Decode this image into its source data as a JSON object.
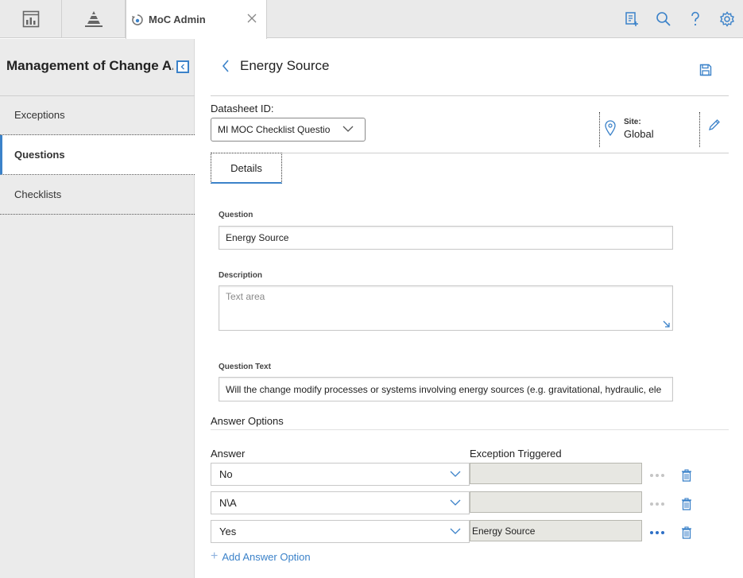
{
  "topbar": {
    "active_tab_label": "MoC Admin",
    "icons": [
      "dashboard-icon",
      "pyramid-icon",
      "moc-tab-icon",
      "close-icon",
      "add-document-icon",
      "search-icon",
      "help-icon",
      "gear-icon"
    ]
  },
  "sidebar": {
    "title": "Management of Change A...",
    "items": [
      {
        "label": "Exceptions",
        "active": false
      },
      {
        "label": "Questions",
        "active": true
      },
      {
        "label": "Checklists",
        "active": false
      }
    ]
  },
  "main": {
    "title": "Energy Source",
    "datasheet_label": "Datasheet ID:",
    "datasheet_value": "MI MOC Checklist Questio",
    "site_label": "Site:",
    "site_value": "Global",
    "tab_details": "Details",
    "fields": {
      "question_label": "Question",
      "question_value": "Energy Source",
      "description_label": "Description",
      "description_placeholder": "Text area",
      "question_text_label": "Question Text",
      "question_text_value": "Will the change modify processes or systems involving energy sources (e.g. gravitational, hydraulic, ele"
    },
    "answer_options": {
      "title": "Answer Options",
      "answer_header": "Answer",
      "exception_header": "Exception Triggered",
      "rows": [
        {
          "answer": "No",
          "exception": ""
        },
        {
          "answer": "N\\A",
          "exception": ""
        },
        {
          "answer": "Yes",
          "exception": "Energy Source"
        }
      ],
      "add_label": "Add Answer Option"
    }
  },
  "colors": {
    "accent": "#3b82c9",
    "sidebar_bg": "#ebebeb",
    "topbar_bg": "#eaeaea"
  }
}
